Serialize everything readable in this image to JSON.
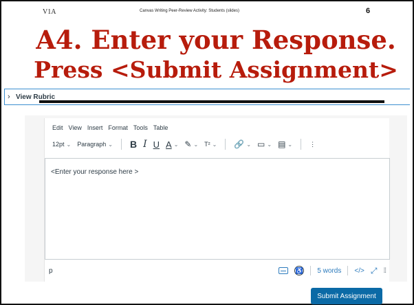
{
  "slide": {
    "header_left": "V1A",
    "header_center": "Canvas Writing Peer-Review Activity: Students (slides)",
    "page_number": "6",
    "title_line1": "A4.  Enter your Response.",
    "title_line2": "Press <Submit Assignment>"
  },
  "rubric": {
    "chevron": "›",
    "label": "View Rubric"
  },
  "editor": {
    "menu": [
      "Edit",
      "View",
      "Insert",
      "Format",
      "Tools",
      "Table"
    ],
    "toolbar": {
      "font_size": "12pt",
      "block_format": "Paragraph",
      "bold": "B",
      "italic": "I",
      "underline": "U",
      "text_color": "A",
      "superscript": "T²",
      "more": "⋮"
    },
    "content": "<Enter your response here >",
    "status": {
      "path": "p",
      "word_count": "5 words",
      "html_toggle": "</>"
    }
  },
  "submit": {
    "label": "Submit Assignment"
  },
  "colors": {
    "title": "#b71c0c",
    "accent": "#0b6aa6",
    "rubric_border": "#3b8ed0"
  }
}
